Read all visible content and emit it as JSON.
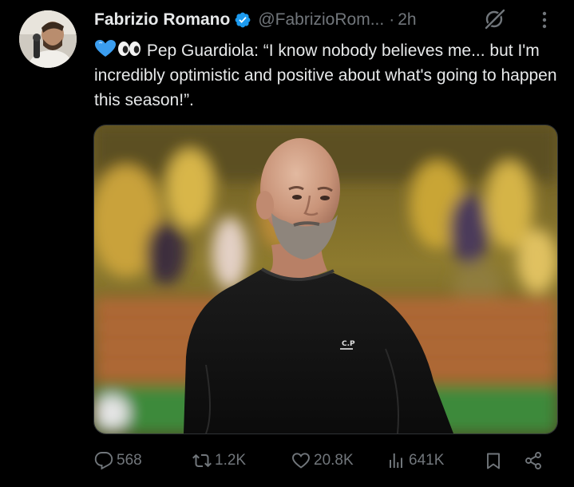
{
  "tweet": {
    "author_name": "Fabrizio Romano",
    "handle": "@FabrizioRom...",
    "separator": "·",
    "time": "2h",
    "text": "Pep Guardiola: “I know nobody believes me... but I'm incredibly optimistic and positive about what's going to happen this season!”."
  },
  "actions": {
    "replies": "568",
    "reposts": "1.2K",
    "likes": "20.8K",
    "views": "641K"
  },
  "colors": {
    "background": "#000000",
    "text": "#e7e9ea",
    "muted": "#71767b",
    "verified_blue": "#1d9bf0"
  },
  "icons": [
    "verified-badge-icon",
    "grok-icon",
    "more-icon",
    "blue-heart-emoji",
    "eyes-emoji",
    "reply-icon",
    "repost-icon",
    "like-icon",
    "views-icon",
    "bookmark-icon",
    "share-icon"
  ]
}
